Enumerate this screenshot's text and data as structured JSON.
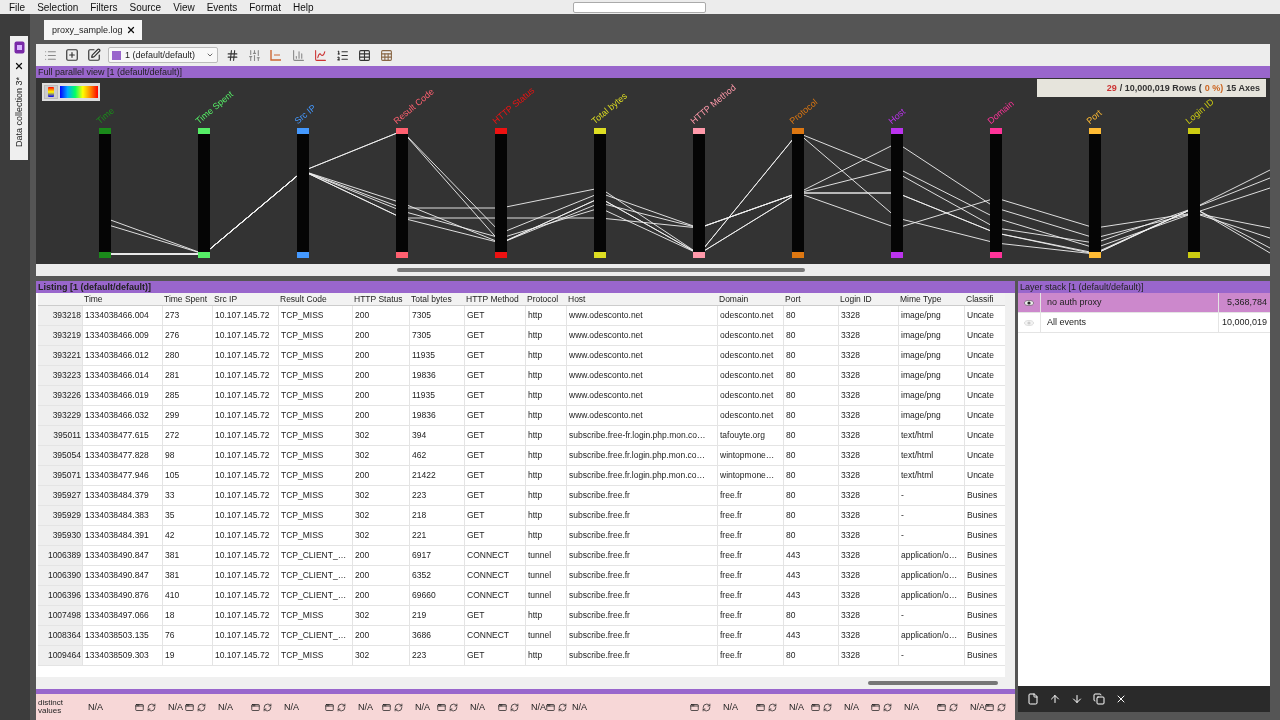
{
  "menu": [
    "File",
    "Selection",
    "Filters",
    "Source",
    "View",
    "Events",
    "Format",
    "Help"
  ],
  "side_tab": {
    "label": "Data collection 3*"
  },
  "document_tab": {
    "label": "proxy_sample.log"
  },
  "toolbar": {
    "layer_selector": "1 (default/default)"
  },
  "parallel_view": {
    "title": "Full parallel view [1 (default/default)]",
    "stats": {
      "selected": "29",
      "total": "/ 10,000,019 Rows (",
      "percent": "0 %)",
      "axes": "15 Axes"
    },
    "axes": [
      {
        "label": "Time",
        "color": "#1a8a1a"
      },
      {
        "label": "Time Spent",
        "color": "#55ee66"
      },
      {
        "label": "Src IP",
        "color": "#4499ff"
      },
      {
        "label": "Result Code",
        "color": "#ff6070"
      },
      {
        "label": "HTTP Status",
        "color": "#ee1111"
      },
      {
        "label": "Total bytes",
        "color": "#dddd22"
      },
      {
        "label": "HTTP Method",
        "color": "#ff99aa"
      },
      {
        "label": "Protocol",
        "color": "#dd7711"
      },
      {
        "label": "Host",
        "color": "#bb33ee"
      },
      {
        "label": "Domain",
        "color": "#ff3399"
      },
      {
        "label": "Port",
        "color": "#ffbb33"
      },
      {
        "label": "Login ID",
        "color": "#cccc11"
      }
    ]
  },
  "listing": {
    "title": "Listing [1 (default/default)]",
    "columns": [
      "Time",
      "Time Spent",
      "Src IP",
      "Result Code",
      "HTTP Status",
      "Total bytes",
      "HTTP Method",
      "Protocol",
      "Host",
      "Domain",
      "Port",
      "Login ID",
      "Mime Type",
      "Classifi"
    ],
    "rows": [
      {
        "index": "393218",
        "cells": [
          "1334038466.004",
          "273",
          "10.107.145.72",
          "TCP_MISS",
          "200",
          "7305",
          "GET",
          "http",
          "www.odesconto.net",
          "odesconto.net",
          "80",
          "3328",
          "image/png",
          "Uncate"
        ]
      },
      {
        "index": "393219",
        "cells": [
          "1334038466.009",
          "276",
          "10.107.145.72",
          "TCP_MISS",
          "200",
          "7305",
          "GET",
          "http",
          "www.odesconto.net",
          "odesconto.net",
          "80",
          "3328",
          "image/png",
          "Uncate"
        ]
      },
      {
        "index": "393221",
        "cells": [
          "1334038466.012",
          "280",
          "10.107.145.72",
          "TCP_MISS",
          "200",
          "11935",
          "GET",
          "http",
          "www.odesconto.net",
          "odesconto.net",
          "80",
          "3328",
          "image/png",
          "Uncate"
        ]
      },
      {
        "index": "393223",
        "cells": [
          "1334038466.014",
          "281",
          "10.107.145.72",
          "TCP_MISS",
          "200",
          "19836",
          "GET",
          "http",
          "www.odesconto.net",
          "odesconto.net",
          "80",
          "3328",
          "image/png",
          "Uncate"
        ]
      },
      {
        "index": "393226",
        "cells": [
          "1334038466.019",
          "285",
          "10.107.145.72",
          "TCP_MISS",
          "200",
          "11935",
          "GET",
          "http",
          "www.odesconto.net",
          "odesconto.net",
          "80",
          "3328",
          "image/png",
          "Uncate"
        ]
      },
      {
        "index": "393229",
        "cells": [
          "1334038466.032",
          "299",
          "10.107.145.72",
          "TCP_MISS",
          "200",
          "19836",
          "GET",
          "http",
          "www.odesconto.net",
          "odesconto.net",
          "80",
          "3328",
          "image/png",
          "Uncate"
        ]
      },
      {
        "index": "395011",
        "cells": [
          "1334038477.615",
          "272",
          "10.107.145.72",
          "TCP_MISS",
          "302",
          "394",
          "GET",
          "http",
          "subscribe.free-fr.login.php.mon.co…",
          "tafouyte.org",
          "80",
          "3328",
          "text/html",
          "Uncate"
        ]
      },
      {
        "index": "395054",
        "cells": [
          "1334038477.828",
          "98",
          "10.107.145.72",
          "TCP_MISS",
          "302",
          "462",
          "GET",
          "http",
          "subscribe.free.fr.login.php.mon.co…",
          "wintopmone…",
          "80",
          "3328",
          "text/html",
          "Uncate"
        ]
      },
      {
        "index": "395071",
        "cells": [
          "1334038477.946",
          "105",
          "10.107.145.72",
          "TCP_MISS",
          "200",
          "21422",
          "GET",
          "http",
          "subscribe.free.fr.login.php.mon.co…",
          "wintopmone…",
          "80",
          "3328",
          "text/html",
          "Uncate"
        ]
      },
      {
        "index": "395927",
        "cells": [
          "1334038484.379",
          "33",
          "10.107.145.72",
          "TCP_MISS",
          "302",
          "223",
          "GET",
          "http",
          "subscribe.free.fr",
          "free.fr",
          "80",
          "3328",
          "-",
          "Busines"
        ]
      },
      {
        "index": "395929",
        "cells": [
          "1334038484.383",
          "35",
          "10.107.145.72",
          "TCP_MISS",
          "302",
          "218",
          "GET",
          "http",
          "subscribe.free.fr",
          "free.fr",
          "80",
          "3328",
          "-",
          "Busines"
        ]
      },
      {
        "index": "395930",
        "cells": [
          "1334038484.391",
          "42",
          "10.107.145.72",
          "TCP_MISS",
          "302",
          "221",
          "GET",
          "http",
          "subscribe.free.fr",
          "free.fr",
          "80",
          "3328",
          "-",
          "Busines"
        ]
      },
      {
        "index": "1006389",
        "cells": [
          "1334038490.847",
          "381",
          "10.107.145.72",
          "TCP_CLIENT_…",
          "200",
          "6917",
          "CONNECT",
          "tunnel",
          "subscribe.free.fr",
          "free.fr",
          "443",
          "3328",
          "application/o…",
          "Busines"
        ]
      },
      {
        "index": "1006390",
        "cells": [
          "1334038490.847",
          "381",
          "10.107.145.72",
          "TCP_CLIENT_…",
          "200",
          "6352",
          "CONNECT",
          "tunnel",
          "subscribe.free.fr",
          "free.fr",
          "443",
          "3328",
          "application/o…",
          "Busines"
        ]
      },
      {
        "index": "1006396",
        "cells": [
          "1334038490.876",
          "410",
          "10.107.145.72",
          "TCP_CLIENT_…",
          "200",
          "69660",
          "CONNECT",
          "tunnel",
          "subscribe.free.fr",
          "free.fr",
          "443",
          "3328",
          "application/o…",
          "Busines"
        ]
      },
      {
        "index": "1007498",
        "cells": [
          "1334038497.066",
          "18",
          "10.107.145.72",
          "TCP_MISS",
          "302",
          "219",
          "GET",
          "http",
          "subscribe.free.fr",
          "free.fr",
          "80",
          "3328",
          "-",
          "Busines"
        ]
      },
      {
        "index": "1008364",
        "cells": [
          "1334038503.135",
          "76",
          "10.107.145.72",
          "TCP_CLIENT_…",
          "200",
          "3686",
          "CONNECT",
          "tunnel",
          "subscribe.free.fr",
          "free.fr",
          "443",
          "3328",
          "application/o…",
          "Busines"
        ]
      },
      {
        "index": "1009464",
        "cells": [
          "1334038509.303",
          "19",
          "10.107.145.72",
          "TCP_MISS",
          "302",
          "223",
          "GET",
          "http",
          "subscribe.free.fr",
          "free.fr",
          "80",
          "3328",
          "-",
          "Busines"
        ]
      }
    ]
  },
  "distinct_values": {
    "label": "distinct values",
    "values": [
      "N/A",
      "N/A",
      "N/A",
      "N/A",
      "N/A",
      "N/A",
      "N/A",
      "N/A",
      "N/A",
      "N/A",
      "N/A",
      "N/A",
      "N/A",
      "N/A"
    ]
  },
  "layer_stack": {
    "title": "Layer stack [1 (default/default)]",
    "layers": [
      {
        "name": "no auth proxy",
        "count": "5,368,784",
        "selected": true,
        "visible": true
      },
      {
        "name": "All events",
        "count": "10,000,019",
        "selected": false,
        "visible": false
      }
    ]
  }
}
